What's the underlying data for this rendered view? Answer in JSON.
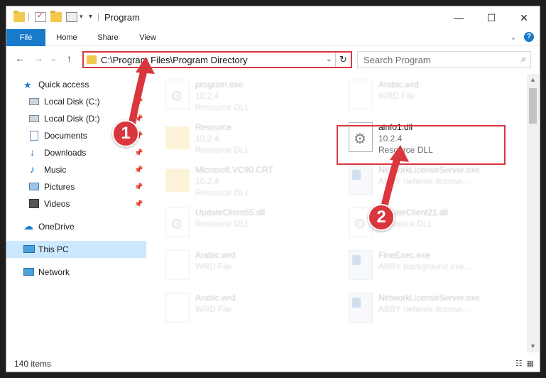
{
  "window": {
    "title": "Program",
    "minimize_glyph": "—",
    "maximize_glyph": "☐",
    "close_glyph": "✕"
  },
  "ribbon": {
    "tabs": [
      "File",
      "Home",
      "Share",
      "View"
    ],
    "expand_glyph": "⌄",
    "help_glyph": "?"
  },
  "nav": {
    "back_glyph": "←",
    "forward_glyph": "→",
    "recent_glyph": "⌄",
    "up_glyph": "↑",
    "address_path": "C:\\Program Files\\Program Directory",
    "address_dropdown_glyph": "⌄",
    "refresh_glyph": "↻",
    "search_placeholder": "Search Program",
    "search_glyph": "⌕"
  },
  "sidebar": {
    "items": [
      {
        "label": "Quick access",
        "icon": "star-icon"
      },
      {
        "label": "Local Disk (C:)",
        "icon": "drive-icon"
      },
      {
        "label": "Local Disk (D:)",
        "icon": "drive-icon"
      },
      {
        "label": "Documents",
        "icon": "documents-icon"
      },
      {
        "label": "Downloads",
        "icon": "download-icon"
      },
      {
        "label": "Music",
        "icon": "music-icon"
      },
      {
        "label": "Pictures",
        "icon": "pictures-icon"
      },
      {
        "label": "Videos",
        "icon": "videos-icon"
      },
      {
        "label": "OneDrive",
        "icon": "cloud-icon"
      },
      {
        "label": "This PC",
        "icon": "computer-icon"
      },
      {
        "label": "Network",
        "icon": "network-icon"
      }
    ],
    "pin_glyph": "📌"
  },
  "files": [
    {
      "name": "program.exe",
      "line1": "10.2.4",
      "line2": "Resource DLL"
    },
    {
      "name": "Arabic.wrd",
      "line1": "WRD File",
      "line2": ""
    },
    {
      "name": "Resource",
      "line1": "10.2.4",
      "line2": "Resource DLL"
    },
    {
      "name": "ainfo1.dll",
      "line1": "10.2.4",
      "line2": "Resource DLL"
    },
    {
      "name": "Microsoft.VC90.CRT",
      "line1": "10.2.4",
      "line2": "Resource DLL"
    },
    {
      "name": "NetworkLicenseServer.exe",
      "line1": "ABBY network license...",
      "line2": ""
    },
    {
      "name": "UpdateClient65.dll",
      "line1": "Resource DLL",
      "line2": ""
    },
    {
      "name": "UpdateClient21.dll",
      "line1": "Resource DLL",
      "line2": ""
    },
    {
      "name": "Arabic.wrd",
      "line1": "WRD File",
      "line2": ""
    },
    {
      "name": "FineExec.exe",
      "line1": "ABBY background exe...",
      "line2": ""
    },
    {
      "name": "Arabic.wrd",
      "line1": "WRD File",
      "line2": ""
    },
    {
      "name": "NetworkLicenseServer.exe",
      "line1": "ABBY network license...",
      "line2": ""
    }
  ],
  "status": {
    "item_count": "140 items",
    "details_view_glyph": "☷",
    "tiles_view_glyph": "▦"
  },
  "annotations": {
    "step1": "1",
    "step2": "2",
    "color": "#d9363e"
  },
  "colors": {
    "accent": "#1979ca",
    "selected_bg": "#cce8ff",
    "highlight_red": "#d9363e"
  }
}
